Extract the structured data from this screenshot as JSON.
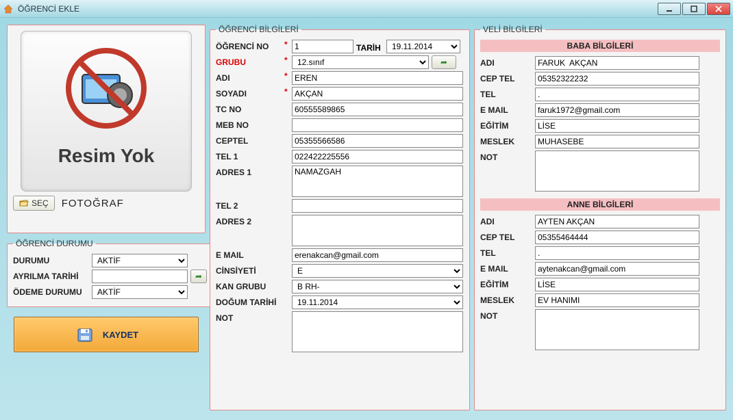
{
  "window": {
    "title": "ÖĞRENCİ EKLE"
  },
  "photo": {
    "no_image_text": "Resim Yok",
    "select_button": "SEÇ",
    "label": "FOTOĞRAF"
  },
  "durum": {
    "legend": "ÖĞRENCİ DURUMU",
    "durumu_label": "DURUMU",
    "durumu_value": "AKTİF",
    "ayrilma_label": "AYRILMA TARİHİ",
    "ayrilma_value": "",
    "odeme_label": "ÖDEME DURUMU",
    "odeme_value": "AKTİF"
  },
  "save_label": "KAYDET",
  "ogrenci": {
    "legend": "ÖĞRENCİ BİLGİLERİ",
    "no_label": "ÖĞRENCİ NO",
    "no_value": "1",
    "tarih_label": "TARİH",
    "tarih_value": "19.11.2014",
    "grubu_label": "GRUBU",
    "grubu_value": "12.sınıf",
    "adi_label": "ADI",
    "adi_value": "EREN",
    "soyadi_label": "SOYADI",
    "soyadi_value": "AKÇAN",
    "tcno_label": "TC NO",
    "tcno_value": "60555589865",
    "mebno_label": "MEB NO",
    "mebno_value": "",
    "ceptel_label": "CEPTEL",
    "ceptel_value": "05355566586",
    "tel1_label": "TEL 1",
    "tel1_value": "022422225556",
    "adres1_label": "ADRES 1",
    "adres1_value": "NAMAZGAH",
    "tel2_label": "TEL 2",
    "tel2_value": "",
    "adres2_label": "ADRES 2",
    "adres2_value": "",
    "email_label": "E MAIL",
    "email_value": "erenakcan@gmail.com",
    "cinsiyet_label": "CİNSİYETİ",
    "cinsiyet_value": "E",
    "kan_label": "KAN GRUBU",
    "kan_value": "B RH-",
    "dogum_label": "DOĞUM TARİHİ",
    "dogum_value": "19.11.2014",
    "not_label": "NOT",
    "not_value": ""
  },
  "veli": {
    "legend": "VELİ BİLGİLERİ",
    "baba_header": "BABA BİLGİLERİ",
    "anne_header": "ANNE BİLGİLERİ",
    "adi_label": "ADI",
    "ceptel_label": "CEP TEL",
    "tel_label": "TEL",
    "email_label": "E MAIL",
    "egitim_label": "EĞİTİM",
    "meslek_label": "MESLEK",
    "not_label": "NOT",
    "baba": {
      "adi": "FARUK  AKÇAN",
      "ceptel": "05352322232",
      "tel": ".",
      "email": "faruk1972@gmail.com",
      "egitim": "LİSE",
      "meslek": "MUHASEBE",
      "not": ""
    },
    "anne": {
      "adi": "AYTEN AKÇAN",
      "ceptel": "05355464444",
      "tel": ".",
      "email": "aytenakcan@gmail.com",
      "egitim": "LİSE",
      "meslek": "EV HANIMI",
      "not": ""
    }
  }
}
